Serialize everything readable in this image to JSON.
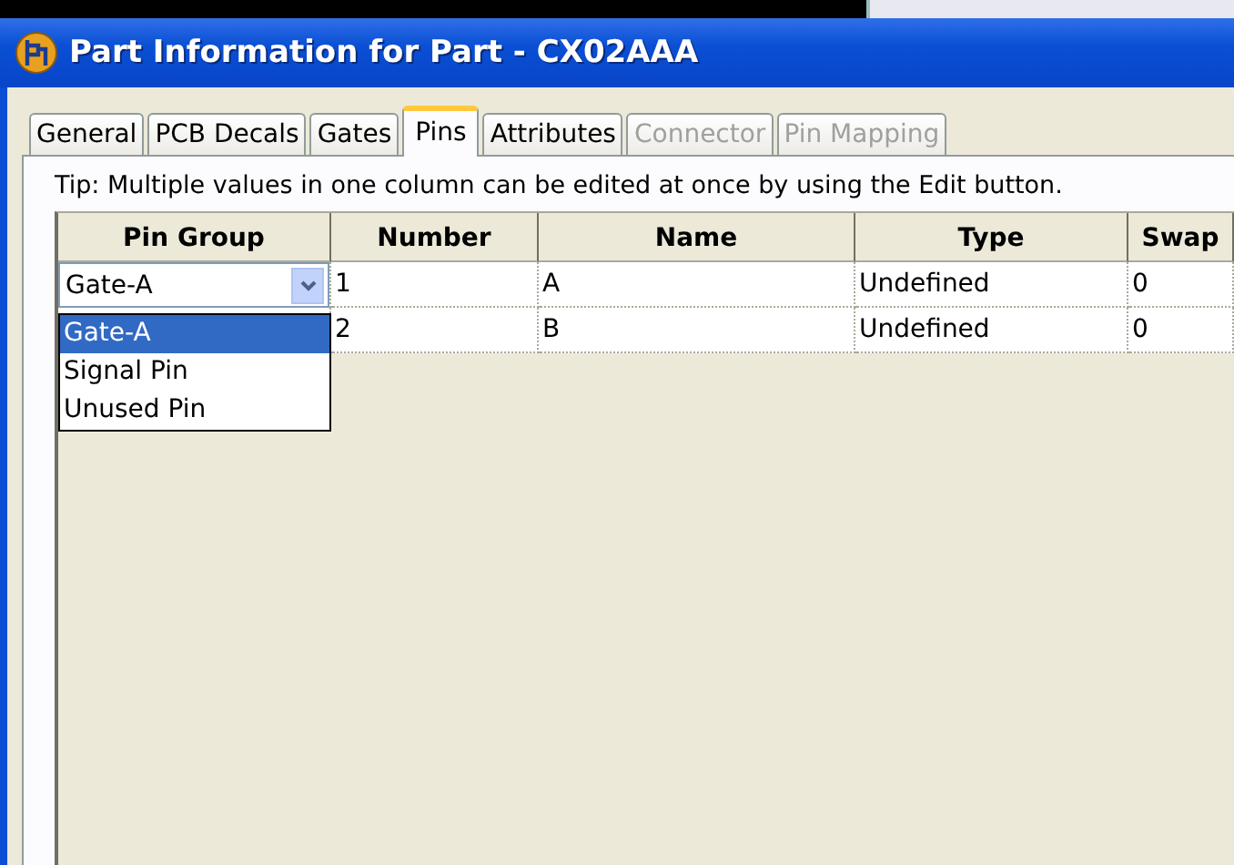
{
  "window": {
    "title": "Part Information for Part - CX02AAA"
  },
  "tabs": [
    {
      "label": "General",
      "selected": false,
      "disabled": false
    },
    {
      "label": "PCB Decals",
      "selected": false,
      "disabled": false
    },
    {
      "label": "Gates",
      "selected": false,
      "disabled": false
    },
    {
      "label": "Pins",
      "selected": true,
      "disabled": false
    },
    {
      "label": "Attributes",
      "selected": false,
      "disabled": false
    },
    {
      "label": "Connector",
      "selected": false,
      "disabled": true
    },
    {
      "label": "Pin Mapping",
      "selected": false,
      "disabled": true
    }
  ],
  "tip": "Tip: Multiple values in one column can be edited at once by using the Edit button.",
  "table": {
    "columns": [
      "Pin Group",
      "Number",
      "Name",
      "Type",
      "Swap"
    ],
    "rows": [
      {
        "cells": [
          "Gate-A",
          "1",
          "A",
          "Undefined",
          "0"
        ]
      },
      {
        "cells": [
          "",
          "2",
          "B",
          "Undefined",
          "0"
        ]
      }
    ]
  },
  "dropdown": {
    "options": [
      {
        "label": "Gate-A",
        "selected": true
      },
      {
        "label": "Signal Pin",
        "selected": false
      },
      {
        "label": "Unused Pin",
        "selected": false
      }
    ]
  }
}
